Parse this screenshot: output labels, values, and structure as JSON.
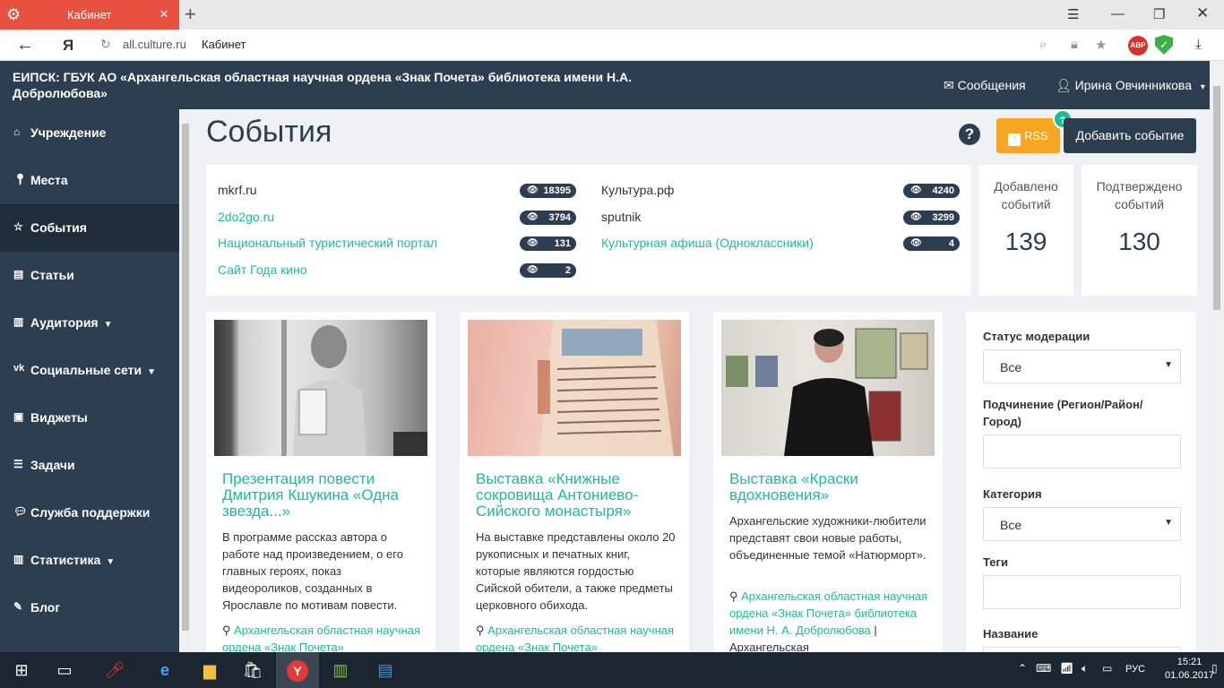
{
  "browser": {
    "tab_title": "Кабинет",
    "url": "all.culture.ru",
    "page_title": "Кабинет",
    "yandex_logo": "Я",
    "abp_label": "ABP"
  },
  "header": {
    "org_name": "ЕИПСК: ГБУК АО «Архангельская областная научная ордена «Знак Почета» библиотека имени Н.А. Добролюбова»",
    "messages": "Сообщения",
    "user": "Ирина Овчинникова"
  },
  "sidebar": {
    "items": [
      {
        "label": "Учреждение",
        "icon": "home-icon"
      },
      {
        "label": "Места",
        "icon": "map-marker-icon"
      },
      {
        "label": "События",
        "icon": "star-icon"
      },
      {
        "label": "Статьи",
        "icon": "newspaper-icon"
      },
      {
        "label": "Аудитория",
        "icon": "bar-chart-icon"
      },
      {
        "label": "Социальные сети",
        "icon": "vk-icon"
      },
      {
        "label": "Виджеты",
        "icon": "image-icon"
      },
      {
        "label": "Задачи",
        "icon": "tasks-icon"
      },
      {
        "label": "Служба поддержки",
        "icon": "comments-icon"
      },
      {
        "label": "Статистика",
        "icon": "bar-chart-icon"
      },
      {
        "label": "Блог",
        "icon": "pencil-icon"
      }
    ],
    "active_index": 2
  },
  "main": {
    "title": "События",
    "rss_label": "RSS",
    "add_label": "Добавить событие",
    "help_mark": "?",
    "help_badge": "?"
  },
  "sources": [
    {
      "name": "mkrf.ru",
      "count": "18395",
      "is_link": false
    },
    {
      "name": "2do2go.ru",
      "count": "3794",
      "is_link": true
    },
    {
      "name": "Национальный туристический портал",
      "count": "131",
      "is_link": true
    },
    {
      "name": "Сайт Года кино",
      "count": "2",
      "is_link": true
    },
    {
      "name": "Культура.рф",
      "count": "4240",
      "is_link": false
    },
    {
      "name": "sputnik",
      "count": "3299",
      "is_link": false
    },
    {
      "name": "Культурная афиша (Одноклассники)",
      "count": "4",
      "is_link": true
    }
  ],
  "stats": {
    "added_label": "Добавлено событий",
    "added_value": "139",
    "confirmed_label": "Подтверждено событий",
    "confirmed_value": "130"
  },
  "cards": [
    {
      "title": "Презентация повести Дмитрия Кшукина «Одна звезда...»",
      "desc": "В программе рассказ автора о работе над произведением, о его главных героях, показ видеороликов, созданных в Ярославле по мотивам повести.",
      "location": "Архангельская областная научная ордена «Знак Почета»",
      "location_extra": ""
    },
    {
      "title": "Выставка «Книжные сокровища Антониево-Сийского монастыря»",
      "desc": "На выставке представлены около 20 рукописных и печатных книг, которые являются гордостью Сийской обители, а также предметы церковного обихода.",
      "location": "Архангельская областная научная ордена «Знак Почета»",
      "location_extra": ""
    },
    {
      "title": "Выставка «Краски вдохновения»",
      "desc": "Архангельские художники-любители представят свои новые работы, объединенные темой «Натюрморт».",
      "location": "Архангельская областная научная ордена «Знак Почета» библиотека имени Н. А. Добролюбова",
      "location_extra": " | Архангельская"
    }
  ],
  "filters": {
    "moderation_label": "Статус модерации",
    "moderation_value": "Все",
    "subordination_label": "Подчинение (Регион/Район/Город)",
    "category_label": "Категория",
    "category_value": "Все",
    "tags_label": "Теги",
    "name_label": "Название"
  },
  "taskbar": {
    "time": "15:21",
    "date": "01.06.2017",
    "lang": "РУС"
  }
}
